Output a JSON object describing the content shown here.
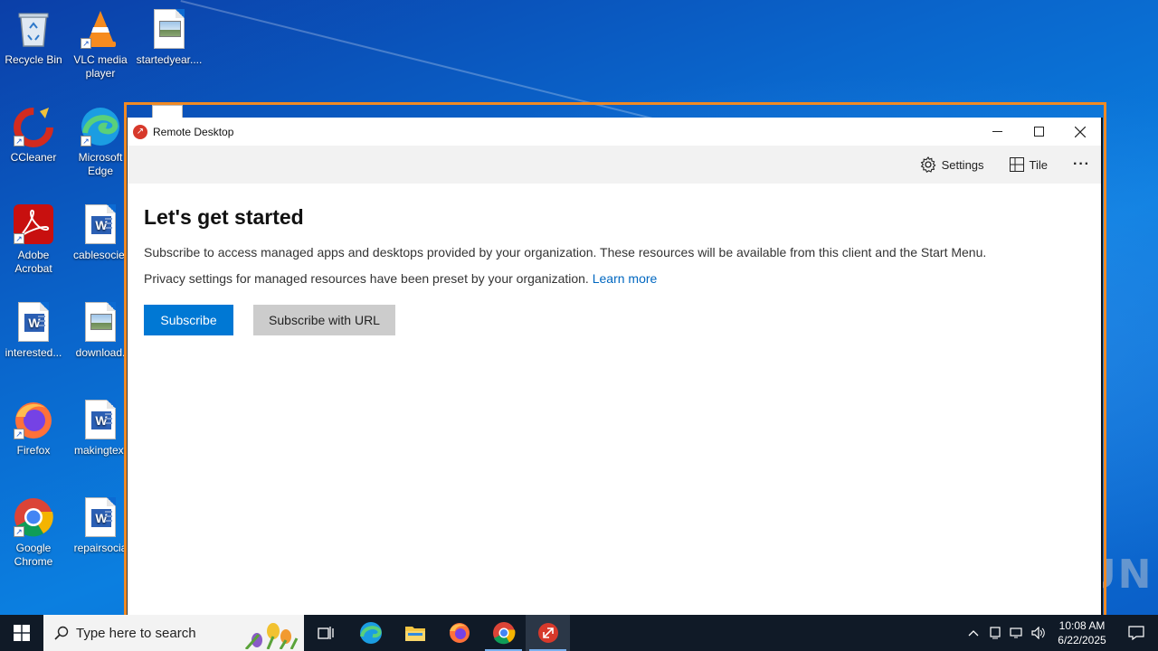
{
  "desktop": {
    "icons": [
      {
        "label": "Recycle Bin"
      },
      {
        "label": "VLC media player"
      },
      {
        "label": "startedyear...."
      },
      {
        "label": "CCleaner"
      },
      {
        "label": "Microsoft Edge"
      },
      {
        "label": "Adobe Acrobat"
      },
      {
        "label": "cablesociet"
      },
      {
        "label": "interested..."
      },
      {
        "label": "download."
      },
      {
        "label": "Firefox"
      },
      {
        "label": "makingtext"
      },
      {
        "label": "Google Chrome"
      },
      {
        "label": "repairsocia"
      }
    ]
  },
  "window": {
    "title": "Remote Desktop",
    "controls": {
      "minimize": "—",
      "maximize": "☐",
      "close": "✕"
    },
    "toolbar": {
      "settings_label": "Settings",
      "tile_label": "Tile",
      "more_label": "···"
    },
    "content": {
      "heading": "Let's get started",
      "description": "Subscribe to access managed apps and desktops provided by your organization. These resources will be available from this client and the Start Menu.",
      "privacy_text": "Privacy settings for managed resources have been preset by your organization.",
      "learn_more": "Learn more",
      "subscribe_label": "Subscribe",
      "subscribe_url_label": "Subscribe with URL"
    }
  },
  "watermark": "ANY RUN",
  "taskbar": {
    "search_placeholder": "Type here to search",
    "clock_time": "10:08 AM",
    "clock_date": "6/22/2025"
  },
  "colors": {
    "accent": "#0078d4",
    "link": "#0067c0",
    "window_outline": "#f08a24",
    "taskbar": "#101a27"
  }
}
